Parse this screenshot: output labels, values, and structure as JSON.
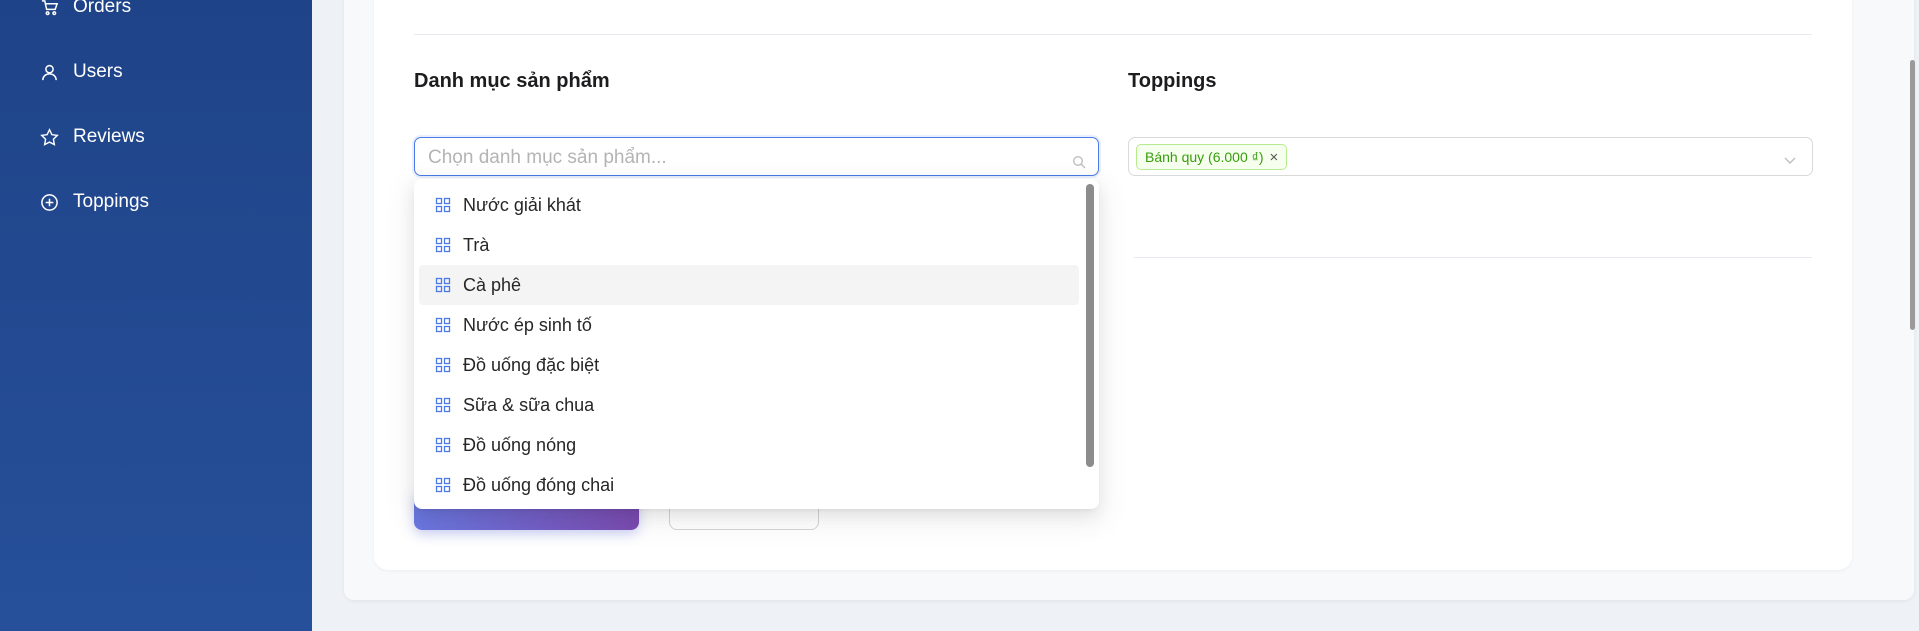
{
  "sidebar": {
    "items": [
      {
        "label": "Orders",
        "icon": "cart-icon"
      },
      {
        "label": "Users",
        "icon": "user-icon"
      },
      {
        "label": "Reviews",
        "icon": "star-icon"
      },
      {
        "label": "Toppings",
        "icon": "plus-circle-icon"
      }
    ]
  },
  "form": {
    "category": {
      "label": "Danh mục sản phẩm",
      "placeholder": "Chọn danh mục sản phẩm..."
    },
    "toppings": {
      "label": "Toppings",
      "selected_tags": [
        "Bánh quy (6.000 ₫)"
      ],
      "tag_remove": "×"
    }
  },
  "dropdown": {
    "options": [
      "Nước giải khát",
      "Trà",
      "Cà phê",
      "Nước ép sinh tố",
      "Đồ uống đặc biệt",
      "Sữa & sữa chua",
      "Đồ uống nóng",
      "Đồ uống đóng chai"
    ],
    "active_option": "Cà phê"
  },
  "colors": {
    "sidebar_bg": "#1f4388",
    "focus_border": "#4a7be8",
    "tag_bg": "#f6ffed",
    "tag_text": "#389e0d",
    "option_icon": "#4a7be8"
  }
}
